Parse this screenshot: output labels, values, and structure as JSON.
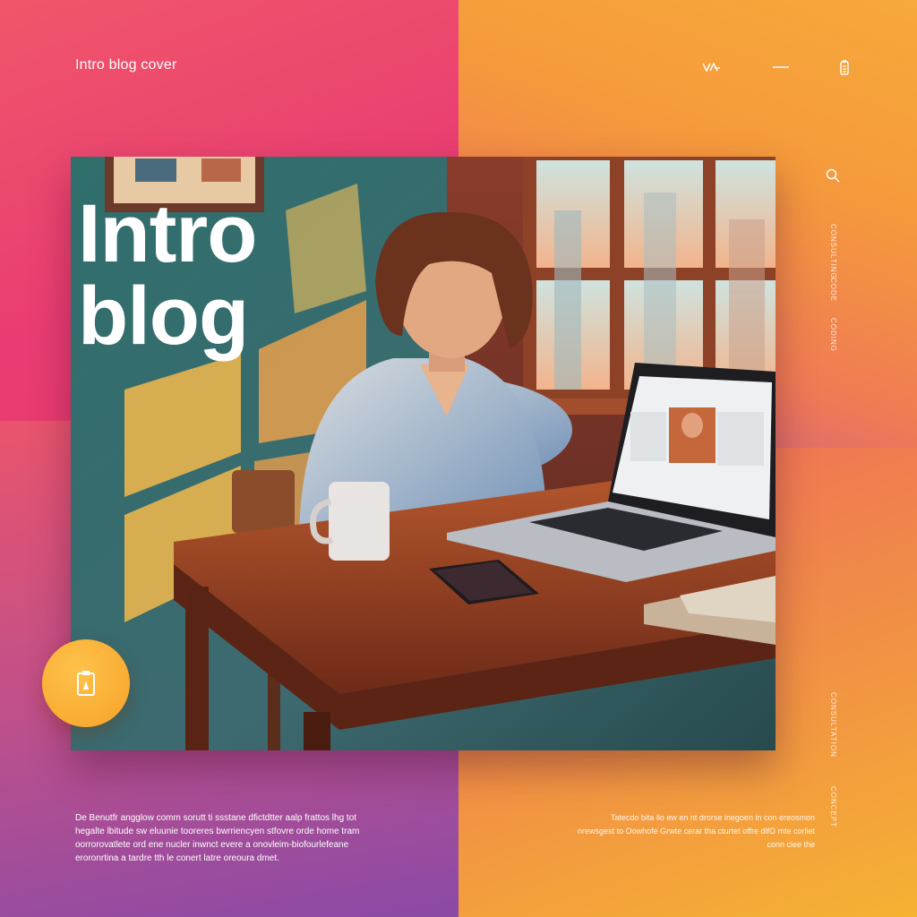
{
  "header": {
    "brand": "Intro blog cover",
    "icons": [
      "logo-mark-icon",
      "minus-icon",
      "clipboard-icon"
    ]
  },
  "hero": {
    "title_line1": "Intro",
    "title_line2": "blog"
  },
  "fab": {
    "icon": "clipboard-icon"
  },
  "right_column": {
    "search_icon": "search-icon",
    "labels": [
      "CONSULTING",
      "CODE",
      "CODING",
      "CONSULTATION",
      "CONCEPT"
    ]
  },
  "footer": {
    "left_text": "De Benutfr angglow comm sorutt ti ssstane dfictdtter aalp frattos lhg tot hegalte lbitude sw eluunie tooreres bwrriencyen stfovre orde home tram oorrorovatlete ord ene nucler inwnct evere a onovleim-biofourlefeane eroronrtina a tardre tth le conert latre oreoura dmet.",
    "right_text": "Tatecdo bita llo ew en nt drorse inegoen in con ereosmon nrewsgest to Oowhofe Grwte cerar tha cturtet offre dlfO mte corliet conn ciee the"
  },
  "colors": {
    "pink": "#e93c72",
    "orange": "#f59a3c",
    "purple": "#8a4aa6",
    "fab_orange": "#f6a228"
  }
}
